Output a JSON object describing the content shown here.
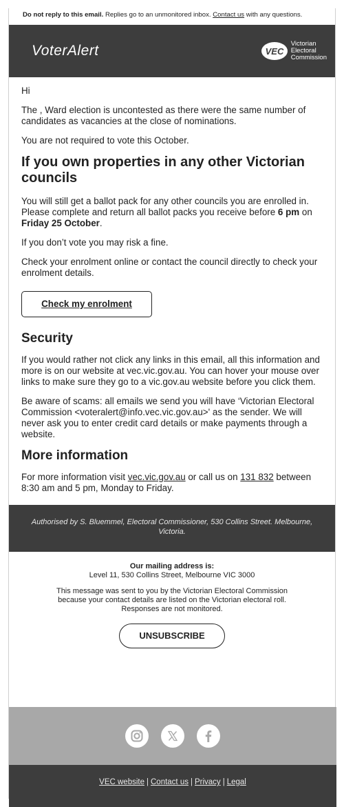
{
  "preheader": {
    "bold": "Do not reply to this email.",
    "text": " Replies go to an unmonitored inbox. ",
    "link": "Contact us",
    "tail": " with any questions."
  },
  "header": {
    "brand": "VoterAlert",
    "logo_abbr": "VEC",
    "logo_line1": "Victorian",
    "logo_line2": "Electoral",
    "logo_line3": "Commission"
  },
  "body": {
    "greeting": "Hi",
    "p1": "The , Ward election is uncontested as there were the same number of candidates as vacancies at the close of nominations.",
    "p2": "You are not required to vote this October.",
    "h_properties": "If you own properties in any other Victorian councils",
    "p3_a": "You will still get a ballot pack for any other councils you are enrolled in. Please complete and return all ballot packs you receive before ",
    "p3_b": "6 pm",
    "p3_c": " on ",
    "p3_d": "Friday 25 October",
    "p3_e": ".",
    "p4": "If you don’t vote you may risk a fine.",
    "p5": "Check your enrolment online or contact the council directly to check your enrolment details.",
    "cta": "Check my enrolment",
    "h_security": "Security",
    "p6": "If you would rather not click any links in this email, all this information and more is on our website at vec.vic.gov.au. You can hover your mouse over links to make sure they go to a vic.gov.au website before you click them.",
    "p7": "Be aware of scams: all emails we send you will have ‘Victorian Electoral Commission <voteralert@info.vec.vic.gov.au>' as the sender. We will never ask you to enter credit card details or make payments through a website.",
    "h_more": "More information",
    "p8_a": "For more information visit ",
    "p8_link1": "vec.vic.gov.au",
    "p8_b": " or call us on ",
    "p8_link2": "131 832",
    "p8_c": " between 8:30 am and 5 pm, Monday to Friday."
  },
  "authorised": "Authorised by S. Bluemmel, Electoral Commissioner, 530 Collins Street. Melbourne, Victoria.",
  "mailing": {
    "heading": "Our mailing address is:",
    "address": "Level 11, 530 Collins Street, Melbourne VIC 3000",
    "notice": "This message was sent to you by the Victorian Electoral Commission because your contact details are listed on the Victorian electoral roll. Responses are not monitored.",
    "unsubscribe": "UNSUBSCRIBE"
  },
  "social": {
    "icons": [
      "instagram-icon",
      "x-icon",
      "facebook-icon"
    ]
  },
  "footer": {
    "links": [
      "VEC website",
      "Contact us",
      "Privacy",
      "Legal"
    ],
    "separator": "|"
  }
}
